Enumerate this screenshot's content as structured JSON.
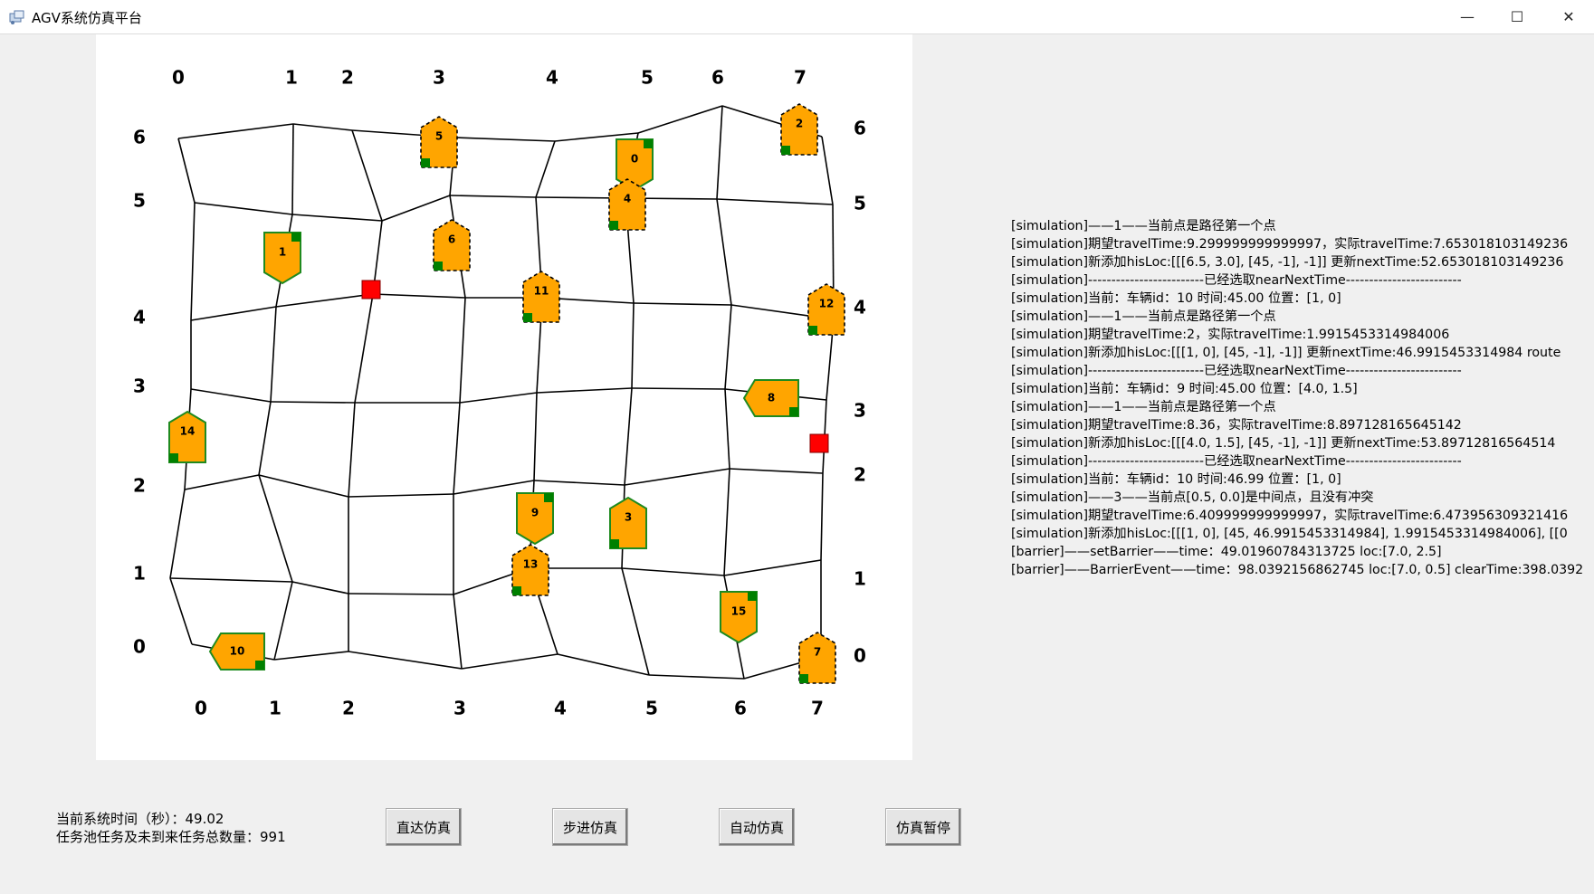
{
  "window": {
    "title": "AGV系统仿真平台",
    "minimize": "—",
    "maximize": "☐",
    "close": "✕"
  },
  "map": {
    "top_labels": [
      "0",
      "1",
      "2",
      "3",
      "4",
      "5",
      "6",
      "7"
    ],
    "bottom_labels": [
      "0",
      "1",
      "2",
      "3",
      "4",
      "5",
      "6",
      "7"
    ],
    "left_labels": [
      "6",
      "5",
      "4",
      "3",
      "2",
      "1",
      "0"
    ],
    "right_labels": [
      "6",
      "5",
      "4",
      "3",
      "2",
      "1",
      "0"
    ],
    "vehicles": [
      "0",
      "1",
      "2",
      "3",
      "4",
      "5",
      "6",
      "7",
      "8",
      "9",
      "10",
      "11",
      "12",
      "13",
      "14",
      "15"
    ],
    "colors": {
      "vehicle_fill": "#ffa500",
      "vehicle_marker": "#008000",
      "barrier": "#ff0000",
      "grid_line": "#000000"
    }
  },
  "log": [
    "[simulation]——1——当前点是路径第一个点",
    "[simulation]期望travelTime:9.299999999999997，实际travelTime:7.653018103149236",
    "[simulation]新添加hisLoc:[[[6.5, 3.0], [45, -1], -1]] 更新nextTime:52.653018103149236",
    "[simulation]-------------------------已经选取nearNextTime-------------------------",
    "[simulation]当前：车辆id：10 时间:45.00 位置：[1, 0]",
    "[simulation]——1——当前点是路径第一个点",
    "[simulation]期望travelTime:2，实际travelTime:1.9915453314984006",
    "[simulation]新添加hisLoc:[[[1, 0], [45, -1], -1]] 更新nextTime:46.9915453314984 route",
    "[simulation]-------------------------已经选取nearNextTime-------------------------",
    "[simulation]当前：车辆id：9 时间:45.00 位置：[4.0, 1.5]",
    "[simulation]——1——当前点是路径第一个点",
    "[simulation]期望travelTime:8.36，实际travelTime:8.897128165645142",
    "[simulation]新添加hisLoc:[[[4.0, 1.5], [45, -1], -1]] 更新nextTime:53.89712816564514",
    "[simulation]-------------------------已经选取nearNextTime-------------------------",
    "[simulation]当前：车辆id：10 时间:46.99 位置：[1, 0]",
    "[simulation]——3——当前点[0.5, 0.0]是中间点，且没有冲突",
    "[simulation]期望travelTime:6.409999999999997，实际travelTime:6.473956309321416",
    "[simulation]新添加hisLoc:[[[1, 0], [45, 46.9915453314984], 1.9915453314984006], [[0",
    "[barrier]——setBarrier——time：49.01960784313725 loc:[7.0, 2.5]",
    "[barrier]——BarrierEvent——time：98.0392156862745 loc:[7.0, 0.5] clearTime:398.0392"
  ],
  "status": {
    "time_label": "当前系统时间（秒）：49.02",
    "tasks_label": "任务池任务及未到来任务总数量：991"
  },
  "buttons": {
    "direct": "直达仿真",
    "step": "步进仿真",
    "auto": "自动仿真",
    "pause": "仿真暂停"
  }
}
